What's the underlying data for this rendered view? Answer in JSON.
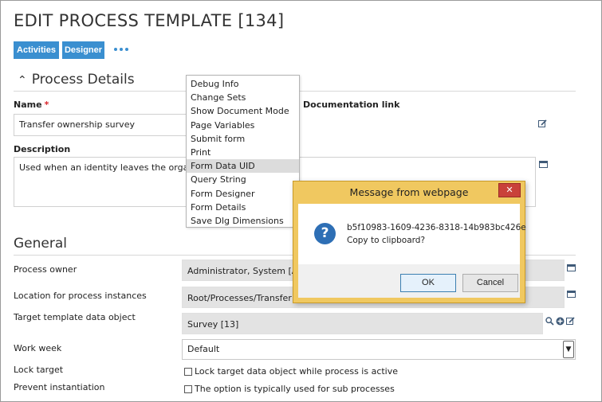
{
  "page": {
    "title": "EDIT PROCESS TEMPLATE [134]",
    "buttons": {
      "activities": "Activities",
      "designer": "Designer"
    }
  },
  "process_details": {
    "header": "Process Details",
    "name": {
      "label": "Name",
      "required_mark": "*",
      "value": "Transfer ownership survey"
    },
    "documentation": {
      "label": "Documentation link"
    },
    "description": {
      "label": "Description",
      "value": "Used when an identity leaves the organizat"
    }
  },
  "context_menu": {
    "items": [
      "Debug Info",
      "Change Sets",
      "Show Document Mode",
      "Page Variables",
      "Submit form",
      "Print",
      "Form Data UID",
      "Query String",
      "Form Designer",
      "Form Details",
      "Save Dlg Dimensions"
    ],
    "highlighted": "Form Data UID"
  },
  "general": {
    "header": "General",
    "process_owner": {
      "label": "Process owner",
      "value": "Administrator, System [ADM"
    },
    "location": {
      "label": "Location for process instances",
      "value": "Root/Processes/Transfer ov"
    },
    "target_template": {
      "label": "Target template data object",
      "value": "Survey [13]"
    },
    "work_week": {
      "label": "Work week",
      "value": "Default"
    },
    "lock_target": {
      "label": "Lock target",
      "checkbox_text": "Lock target data object while process is active",
      "checked": false
    },
    "prevent_instantiation": {
      "label": "Prevent instantiation",
      "checkbox_text": "The option is typically used for sub processes",
      "checked": false
    }
  },
  "dialog": {
    "title": "Message from webpage",
    "close_glyph": "✕",
    "icon_glyph": "?",
    "message_line1": "b5f10983-1609-4236-8318-14b983bc426e",
    "message_line2": "Copy to clipboard?",
    "ok_label": "OK",
    "cancel_label": "Cancel"
  },
  "colors": {
    "accent_blue": "#3a8fd0",
    "dialog_frame": "#f0c860",
    "close_red": "#c9413a",
    "required_red": "#d9262c",
    "readonly_gray": "#e3e3e3"
  }
}
